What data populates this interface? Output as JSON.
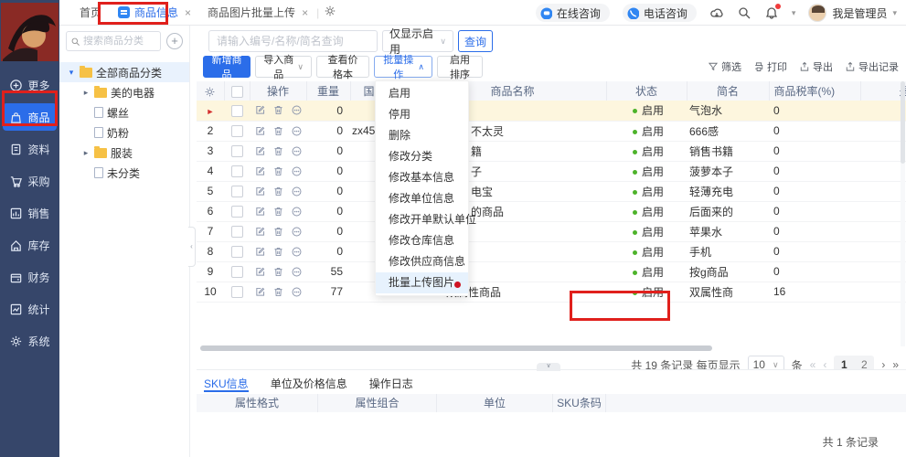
{
  "topbar": {
    "tabs": [
      {
        "label": "首页"
      },
      {
        "label": "商品信息",
        "close": "×"
      },
      {
        "label": "商品图片批量上传",
        "close": "×"
      }
    ],
    "right": {
      "online": "在线咨询",
      "phone": "电话咨询",
      "user": "我是管理员"
    }
  },
  "sidebar": {
    "items": [
      {
        "label": "更多"
      },
      {
        "label": "商品"
      },
      {
        "label": "资料"
      },
      {
        "label": "采购"
      },
      {
        "label": "销售"
      },
      {
        "label": "库存"
      },
      {
        "label": "财务"
      },
      {
        "label": "统计"
      },
      {
        "label": "系统"
      }
    ]
  },
  "tree": {
    "search_placeholder": "搜索商品分类",
    "items": [
      {
        "label": "全部商品分类"
      },
      {
        "label": "美的电器"
      },
      {
        "label": "螺丝"
      },
      {
        "label": "奶粉"
      },
      {
        "label": "服装"
      },
      {
        "label": "未分类"
      }
    ]
  },
  "filters": {
    "search_placeholder": "请输入编号/名称/简名查询",
    "status_filter": "仅显示启用",
    "query": "查询"
  },
  "actions": {
    "add": "新增商品",
    "import": "导入商品",
    "price_book": "查看价格本",
    "batch": "批量操作",
    "enable_sort": "启用排序",
    "tools": [
      "筛选",
      "打印",
      "导出",
      "导出记录"
    ]
  },
  "dropdown": {
    "items": [
      "启用",
      "停用",
      "删除",
      "修改分类",
      "修改基本信息",
      "修改单位信息",
      "修改开单默认单位",
      "修改仓库信息",
      "修改供应商信息",
      "批量上传图片"
    ]
  },
  "table": {
    "columns": {
      "op": "操作",
      "weight": "重量",
      "code": "国",
      "name": "商品名称",
      "status": "状态",
      "short_name": "简名",
      "tax": "商品税率(%)",
      "last": "是"
    },
    "rows": [
      {
        "sn": "",
        "weight": "0",
        "code": "",
        "name": "",
        "status": "启用",
        "short": "气泡水",
        "tax": "0"
      },
      {
        "sn": "2",
        "weight": "0",
        "code": "zx45",
        "name": "不太灵",
        "status": "启用",
        "short": "666感",
        "tax": "0"
      },
      {
        "sn": "3",
        "weight": "0",
        "code": "",
        "name": "籍",
        "status": "启用",
        "short": "销售书籍",
        "tax": "0"
      },
      {
        "sn": "4",
        "weight": "0",
        "code": "",
        "name": "子",
        "status": "启用",
        "short": "菠萝本子",
        "tax": "0"
      },
      {
        "sn": "5",
        "weight": "0",
        "code": "",
        "name": "电宝",
        "status": "启用",
        "short": "轻薄充电",
        "tax": "0"
      },
      {
        "sn": "6",
        "weight": "0",
        "code": "",
        "name": "的商品",
        "status": "启用",
        "short": "后面来的",
        "tax": "0"
      },
      {
        "sn": "7",
        "weight": "0",
        "code": "",
        "name": "",
        "status": "启用",
        "short": "苹果水",
        "tax": "0"
      },
      {
        "sn": "8",
        "weight": "0",
        "code": "",
        "name": "",
        "status": "启用",
        "short": "手机",
        "tax": "0"
      },
      {
        "sn": "9",
        "weight": "55",
        "code": "",
        "name": "",
        "status": "启用",
        "short": "按g商品",
        "tax": "0"
      },
      {
        "sn": "10",
        "weight": "77",
        "code": "",
        "name": "双属性商品",
        "status": "启用",
        "short": "双属性商",
        "tax": "16"
      }
    ]
  },
  "pagination": {
    "total_text": "共 19 条记录 每页显示",
    "page_size": "10",
    "unit": "条",
    "first": "«",
    "prev": "‹",
    "next": "›",
    "last": "»",
    "pages": [
      "1",
      "2"
    ]
  },
  "detail": {
    "tabs": [
      "SKU信息",
      "单位及价格信息",
      "操作日志"
    ],
    "columns": [
      "属性格式",
      "属性组合",
      "单位",
      "SKU条码"
    ],
    "total_text": "共 1 条记录"
  },
  "colors": {
    "accent": "#2b6de9",
    "status_green": "#4db32a",
    "annotation_red": "#e0201c",
    "row_highlight": "#fdf6de"
  }
}
